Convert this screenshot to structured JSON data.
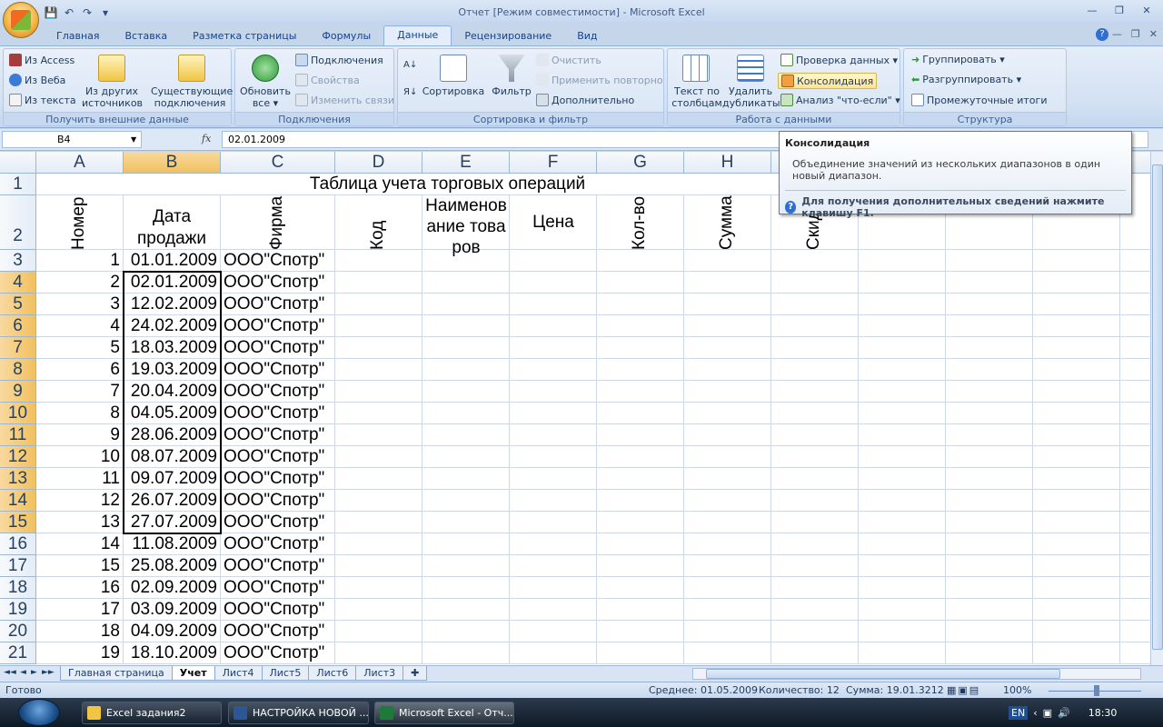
{
  "window": {
    "title": "Отчет  [Режим совместимости] - Microsoft Excel",
    "controls": [
      "—",
      "❐",
      "✕"
    ]
  },
  "qat": [
    "💾",
    "↶",
    "↷",
    "▾"
  ],
  "tabs": [
    "Главная",
    "Вставка",
    "Разметка страницы",
    "Формулы",
    "Данные",
    "Рецензирование",
    "Вид"
  ],
  "active_tab": "Данные",
  "ribbon": {
    "get_external": {
      "label": "Получить внешние данные",
      "from_access": "Из Access",
      "from_web": "Из Веба",
      "from_text": "Из текста",
      "other_sources_1": "Из других",
      "other_sources_2": "источников ▾",
      "existing_1": "Существующие",
      "existing_2": "подключения"
    },
    "connections": {
      "label": "Подключения",
      "refresh_1": "Обновить",
      "refresh_2": "все ▾",
      "connections": "Подключения",
      "properties": "Свойства",
      "edit_links": "Изменить связи"
    },
    "sort_filter": {
      "label": "Сортировка и фильтр",
      "sort": "Сортировка",
      "filter": "Фильтр",
      "clear": "Очистить",
      "reapply": "Применить повторно",
      "advanced": "Дополнительно"
    },
    "data_tools": {
      "label": "Работа с данными",
      "text_to_cols_1": "Текст по",
      "text_to_cols_2": "столбцам",
      "remove_dup_1": "Удалить",
      "remove_dup_2": "дубликаты",
      "validation": "Проверка данных ▾",
      "consolidate": "Консолидация",
      "whatif": "Анализ \"что-если\" ▾"
    },
    "outline": {
      "label": "Структура",
      "group": "Группировать ▾",
      "ungroup": "Разгруппировать ▾",
      "subtotal": "Промежуточные итоги"
    }
  },
  "formula_bar": {
    "name_box": "B4",
    "fx": "fx",
    "value": "02.01.2009"
  },
  "tooltip": {
    "title": "Консолидация",
    "body": "Объединение значений из нескольких диапазонов в один новый диапазон.",
    "help": "Для получения дополнительных сведений нажмите клавишу F1."
  },
  "sheet": {
    "columns": [
      "A",
      "B",
      "C",
      "D",
      "E",
      "F",
      "G",
      "H",
      "I",
      "J",
      "K",
      "L",
      "M"
    ],
    "title": "Таблица учета торговых операций",
    "headers": {
      "A": "Номер",
      "B": "Дата продажи",
      "C": "Фирма",
      "D": "Код",
      "E": "Наименов ание товаров",
      "F": "Цена",
      "G": "Кол-во",
      "H": "Сумма",
      "I": "Скидк"
    },
    "row_numbers": [
      "1",
      "2",
      "3",
      "4",
      "5",
      "6",
      "7",
      "8",
      "9",
      "10",
      "11",
      "12",
      "13",
      "14",
      "15",
      "16",
      "17",
      "18",
      "19",
      "20",
      "21"
    ],
    "rows": [
      [
        "1",
        "01.01.2009",
        "ООО\"Спотр\""
      ],
      [
        "2",
        "02.01.2009",
        "ООО\"Спотр\""
      ],
      [
        "3",
        "12.02.2009",
        "ООО\"Спотр\""
      ],
      [
        "4",
        "24.02.2009",
        "ООО\"Спотр\""
      ],
      [
        "5",
        "18.03.2009",
        "ООО\"Спотр\""
      ],
      [
        "6",
        "19.03.2009",
        "ООО\"Спотр\""
      ],
      [
        "7",
        "20.04.2009",
        "ООО\"Спотр\""
      ],
      [
        "8",
        "04.05.2009",
        "ООО\"Спотр\""
      ],
      [
        "9",
        "28.06.2009",
        "ООО\"Спотр\""
      ],
      [
        "10",
        "08.07.2009",
        "ООО\"Спотр\""
      ],
      [
        "11",
        "09.07.2009",
        "ООО\"Спотр\""
      ],
      [
        "12",
        "26.07.2009",
        "ООО\"Спотр\""
      ],
      [
        "13",
        "27.07.2009",
        "ООО\"Спотр\""
      ],
      [
        "14",
        "11.08.2009",
        "ООО\"Спотр\""
      ],
      [
        "15",
        "25.08.2009",
        "ООО\"Спотр\""
      ],
      [
        "16",
        "02.09.2009",
        "ООО\"Спотр\""
      ],
      [
        "17",
        "03.09.2009",
        "ООО\"Спотр\""
      ],
      [
        "18",
        "04.09.2009",
        "ООО\"Спотр\""
      ],
      [
        "19",
        "18.10.2009",
        "ООО\"Спотр\""
      ]
    ],
    "selected_range": "B4:B15"
  },
  "sheet_tabs": [
    "Главная страница",
    "Учет",
    "Лист4",
    "Лист5",
    "Лист6",
    "Лист3"
  ],
  "active_sheet": "Учет",
  "status": {
    "ready": "Готово",
    "average": "Среднее: 01.05.2009",
    "count": "Количество: 12",
    "sum": "Сумма: 19.01.3212",
    "zoom": "100%"
  },
  "taskbar": {
    "items": [
      "Excel задания2",
      "НАСТРОЙКА НОВОЙ ...",
      "Microsoft Excel - Отч..."
    ],
    "lang": "EN",
    "clock": "18:30"
  },
  "colors": {
    "accent": "#15428b",
    "selection_header": "#f1c15f",
    "ribbon": "#d3e1f3"
  }
}
